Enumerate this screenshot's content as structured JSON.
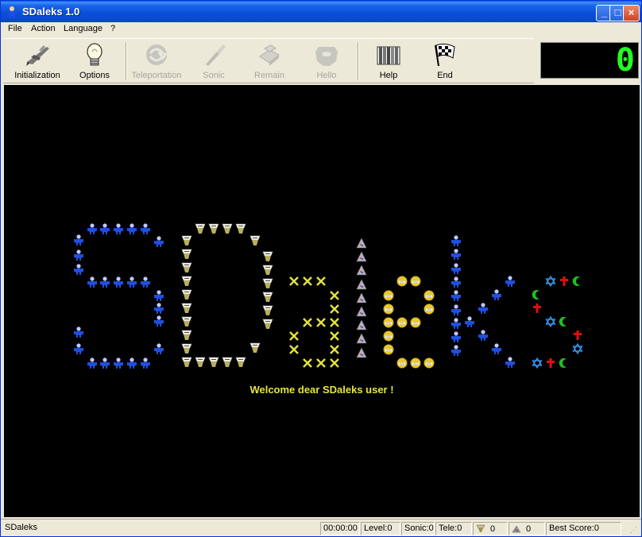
{
  "window": {
    "title": "SDaleks 1.0"
  },
  "menu": [
    "File",
    "Action",
    "Language",
    "?"
  ],
  "toolbar": {
    "initialization": "Initialization",
    "options": "Options",
    "teleportation": "Teleportation",
    "sonic": "Sonic",
    "remain": "Remain",
    "hello": "Hello",
    "help": "Help",
    "end": "End"
  },
  "counter": "0",
  "game": {
    "welcome": "Welcome dear SDaleks user !",
    "colors": {
      "background": "#000000",
      "welcome_text": "#e5e53a",
      "counter_digit": "#22ff22"
    }
  },
  "status": {
    "app_name": "SDaleks",
    "time": "00:00:00",
    "level": "Level:0",
    "sonic": "Sonic:0",
    "tele": "Tele:0",
    "daleks": "0",
    "scrap": "0",
    "best_score": "Best Score:0"
  }
}
